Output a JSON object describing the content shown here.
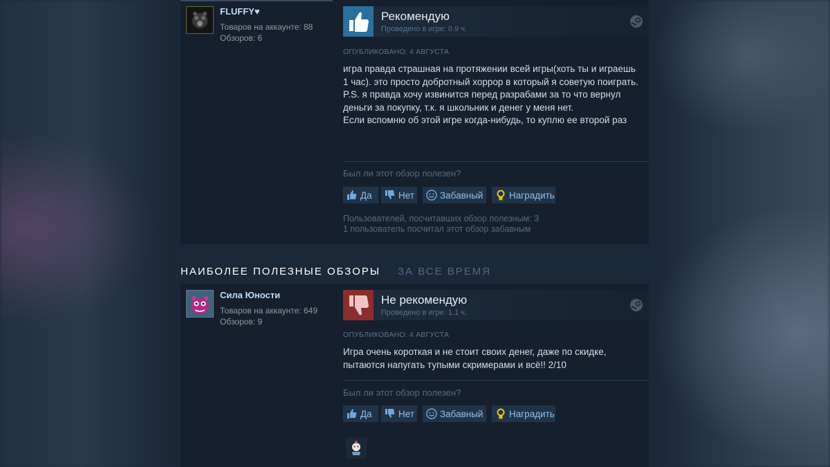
{
  "reviews": [
    {
      "username": "FLUFFY♥",
      "products": "Товаров на аккаунте: 88",
      "reviews_count": "Обзоров: 6",
      "verdict": "Рекомендую",
      "recommended": true,
      "hours": "Проведено в игре: 0.9 ч.",
      "posted": "Опубликовано: 4 августа",
      "body": [
        "игра правда страшная на протяжении всей игры(хоть ты и играешь 1 час). это просто добротный хоррор в который я советую поиграть.",
        "P.S. я правда хочу извинится перед разрабами за то что вернул деньги за покупку, т.к. я школьник и денег у меня нет.",
        "Если вспомню об этой игре когда-нибудь, то куплю ее второй раз"
      ],
      "helpful_question": "Был ли этот обзор полезен?",
      "buttons": {
        "yes": "Да",
        "no": "Нет",
        "funny": "Забавный",
        "award": "Наградить"
      },
      "helpful_count": "Пользователей, посчитавших обзор полезным: 3",
      "funny_count": "1 пользователь посчитал этот обзор забавным"
    },
    {
      "username": "Сила Юности",
      "products": "Товаров на аккаунте: 649",
      "reviews_count": "Обзоров: 9",
      "verdict": "Не рекомендую",
      "recommended": false,
      "hours": "Проведено в игре: 1.1 ч.",
      "posted": "Опубликовано: 4 августа",
      "body": [
        "Игра очень короткая и не стоит своих денег, даже по скидке, пытаются напугать тупыми скримерами и всё!! 2/10"
      ],
      "helpful_question": "Был ли этот обзор полезен?",
      "buttons": {
        "yes": "Да",
        "no": "Нет",
        "funny": "Забавный",
        "award": "Наградить"
      }
    }
  ],
  "section": {
    "title": "НАИБОЛЕЕ ПОЛЕЗНЫЕ ОБЗОРЫ",
    "subtitle": "ЗА ВСЕ ВРЕМЯ"
  },
  "colors": {
    "background": "#1b2838",
    "card": "#16202d",
    "recommend": "#2b6f9e",
    "not_recommend": "#8a2d2d",
    "link": "#8fbfe8"
  }
}
